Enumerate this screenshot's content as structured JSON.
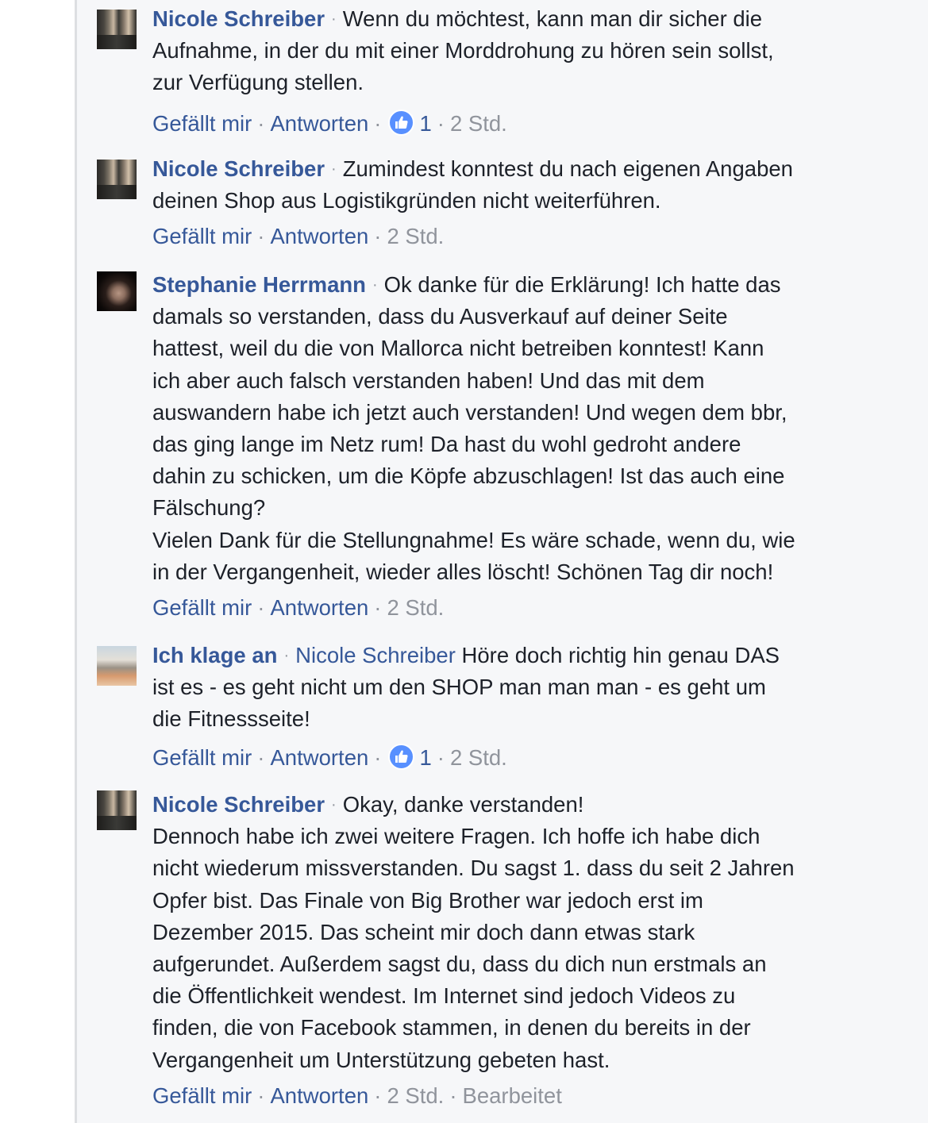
{
  "actions_labels": {
    "like": "Gefällt mir",
    "reply": "Antworten",
    "edited": "Bearbeitet"
  },
  "comments": [
    {
      "author": "Nicole Schreiber",
      "text_lines": [
        "Wenn du möchtest, kann man dir sicher die",
        "Aufnahme, in der du mit einer Morddrohung zu hören sein sollst,",
        "zur Verfügung stellen."
      ],
      "reaction_count": "1",
      "time": "2 Std."
    },
    {
      "author": "Nicole Schreiber",
      "text_lines": [
        "Zumindest konntest du nach eigenen Angaben",
        "deinen Shop aus Logistikgründen nicht weiterführen."
      ],
      "time": "2 Std."
    },
    {
      "author": "Stephanie Herrmann",
      "text_lines": [
        "Ok danke für die Erklärung! Ich hatte das",
        "damals so verstanden, dass du Ausverkauf auf deiner Seite",
        "hattest, weil du die von Mallorca nicht betreiben konntest! Kann",
        "ich aber auch falsch verstanden haben! Und das mit dem",
        "auswandern habe ich jetzt auch verstanden! Und wegen dem bbr,",
        "das ging lange im Netz rum! Da hast du wohl gedroht andere",
        "dahin zu schicken, um die Köpfe abzuschlagen! Ist das auch eine",
        "Fälschung?",
        "Vielen Dank für die Stellungnahme! Es wäre schade, wenn du, wie",
        "in der Vergangenheit, wieder alles löscht! Schönen Tag dir noch!"
      ],
      "time": "2 Std."
    },
    {
      "author": "Ich klage an",
      "mention": "Nicole Schreiber",
      "text_lines": [
        "Höre doch richtig hin genau DAS",
        "ist es - es geht nicht um den SHOP man man man - es geht um",
        "die Fitnessseite!"
      ],
      "reaction_count": "1",
      "time": "2 Std."
    },
    {
      "author": "Nicole Schreiber",
      "text_lines": [
        "Okay, danke verstanden!",
        "Dennoch habe ich zwei weitere Fragen. Ich hoffe ich habe dich",
        "nicht wiederum missverstanden. Du sagst 1. dass du seit 2 Jahren",
        "Opfer bist. Das Finale von Big Brother war jedoch erst im",
        "Dezember 2015. Das scheint mir doch dann etwas stark",
        "aufgerundet. Außerdem sagst du, dass du dich nun erstmals an",
        "die Öffentlichkeit wendest. Im Internet sind jedoch Videos zu",
        "finden, die von Facebook stammen, in denen du bereits in der",
        "Vergangenheit um Unterstützung gebeten hast."
      ],
      "time": "2 Std.",
      "edited": true
    }
  ],
  "colors": {
    "link": "#365899",
    "meta": "#90949c",
    "text": "#1d2129",
    "background": "#f6f7f9",
    "like_badge": "#5890ff"
  },
  "icons": {
    "reaction": "thumbs-up-icon"
  }
}
